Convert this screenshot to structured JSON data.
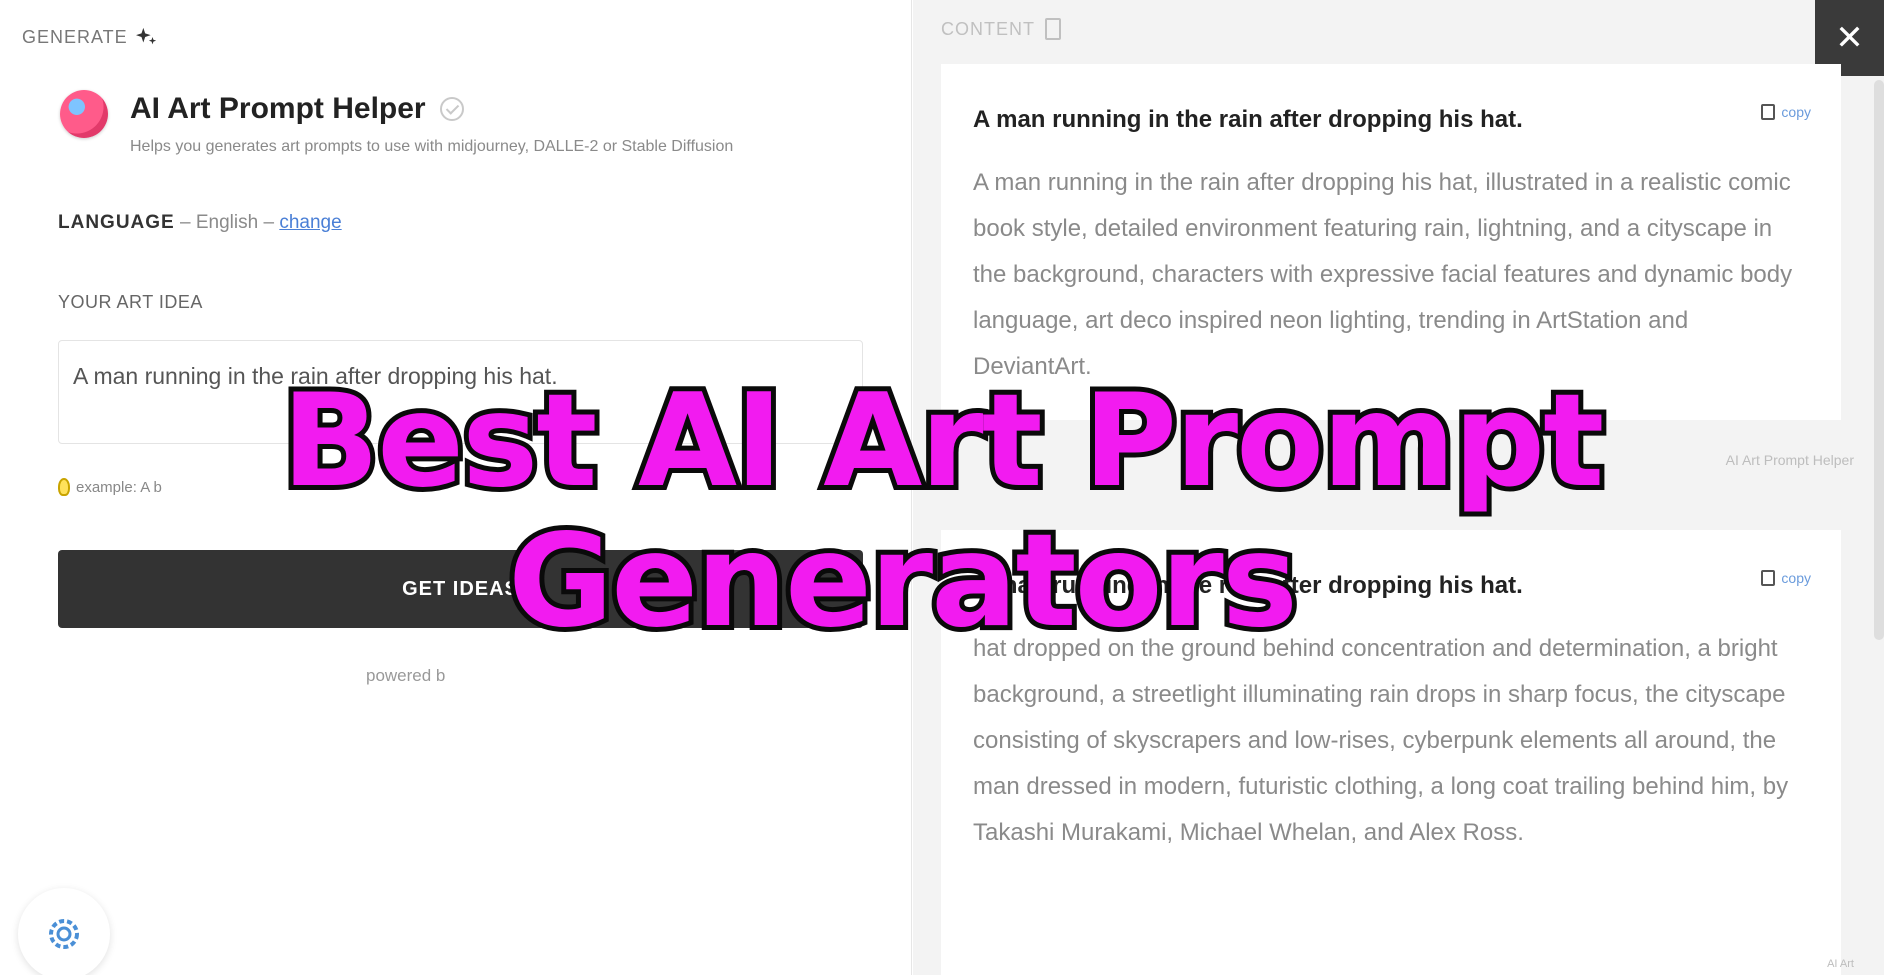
{
  "left": {
    "section_label": "GENERATE",
    "app": {
      "title": "AI Art Prompt Helper",
      "subtitle": "Helps you generates art prompts to use with midjourney, DALLE-2 or Stable Diffusion"
    },
    "language": {
      "key": "LANGUAGE",
      "separator": " – ",
      "value": "English",
      "change_label": "change"
    },
    "idea": {
      "label": "YOUR ART IDEA",
      "value": "A man running in the rain after dropping his hat."
    },
    "example_text": "example: A b",
    "get_ideas_label": "GET IDEAS",
    "powered_by": "powered b"
  },
  "right": {
    "section_label": "CONTENT",
    "close_label": "✕",
    "cards": [
      {
        "title": "A man running in the rain after dropping his hat.",
        "copy_label": "copy",
        "body": "A man running in the rain after dropping his hat, illustrated in a realistic comic book style, detailed environment featuring rain, lightning, and a cityscape in the background, characters with expressive facial features and dynamic body language, art deco inspired neon lighting, trending in ArtStation and DeviantArt.",
        "footer": "AI Art Prompt Helper"
      },
      {
        "title": "A man running in the rain after dropping his hat.",
        "copy_label": "copy",
        "body": "hat dropped on the ground behind concentration and determination, a bright background, a streetlight illuminating rain drops in sharp focus, the cityscape consisting of skyscrapers and low-rises, cyberpunk elements all around, the man dressed in modern, futuristic clothing, a long coat trailing behind him, by Takashi Murakami, Michael Whelan, and Alex Ross.",
        "footer": "AI Art"
      }
    ]
  },
  "overlay": {
    "line1": "Best AI Art Prompt",
    "line2": "Generators"
  },
  "colors": {
    "overlay_fill": "#f21bf0",
    "button_dark": "#333333",
    "link_blue": "#4a7fd6"
  }
}
